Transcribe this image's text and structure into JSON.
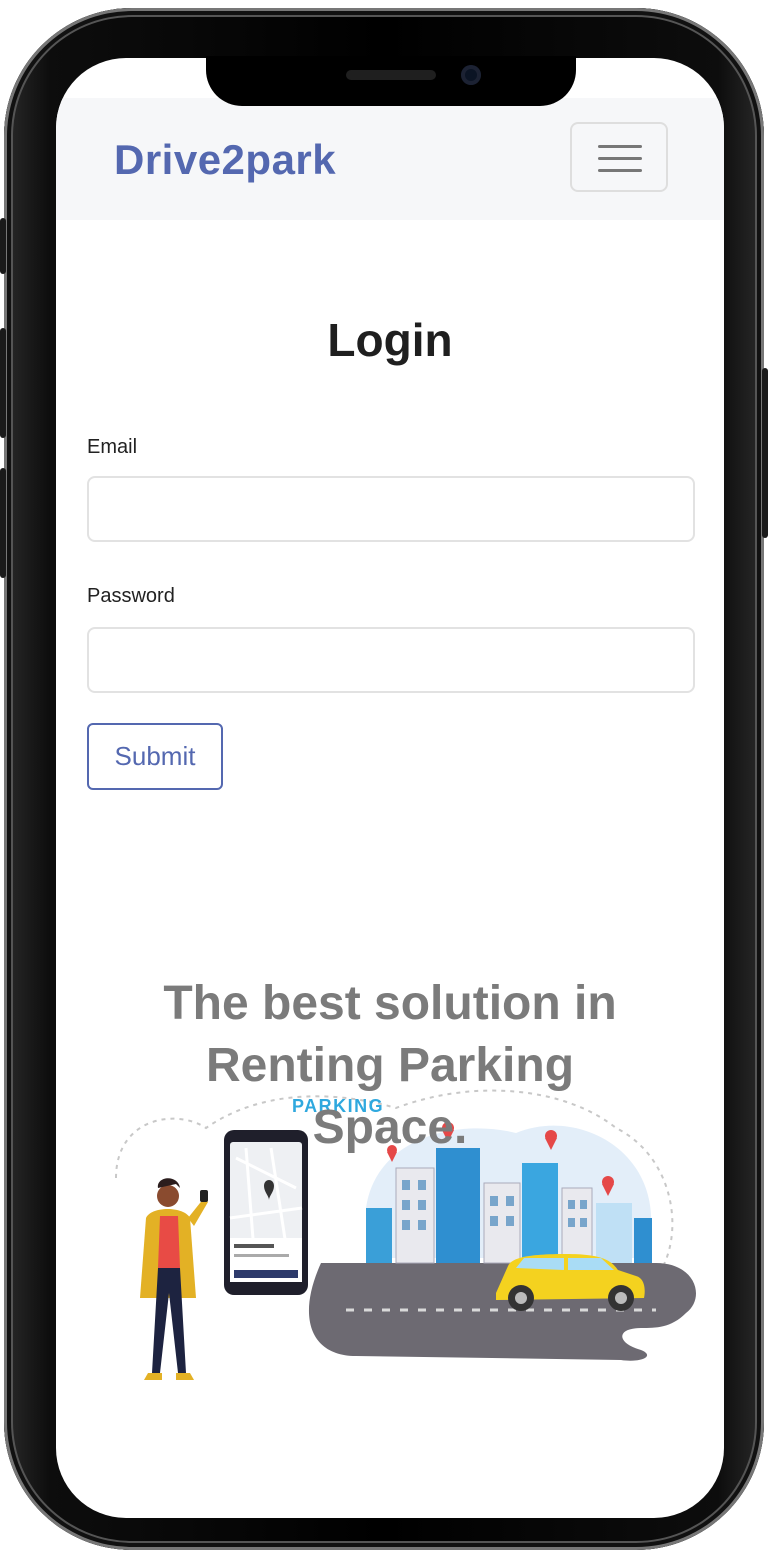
{
  "navbar": {
    "brand": "Drive2park",
    "menu_icon": "hamburger-menu-icon"
  },
  "login": {
    "title": "Login",
    "email_label": "Email",
    "email_value": "",
    "password_label": "Password",
    "password_value": "",
    "submit_label": "Submit"
  },
  "hero": {
    "tagline": "The best solution in Renting Parking Space.",
    "parking_sign": "PARKING"
  },
  "colors": {
    "brand": "#5468b0",
    "navbar_bg": "#f6f7f9",
    "tagline": "#7b7b7b",
    "taxi": "#f4d21f"
  }
}
